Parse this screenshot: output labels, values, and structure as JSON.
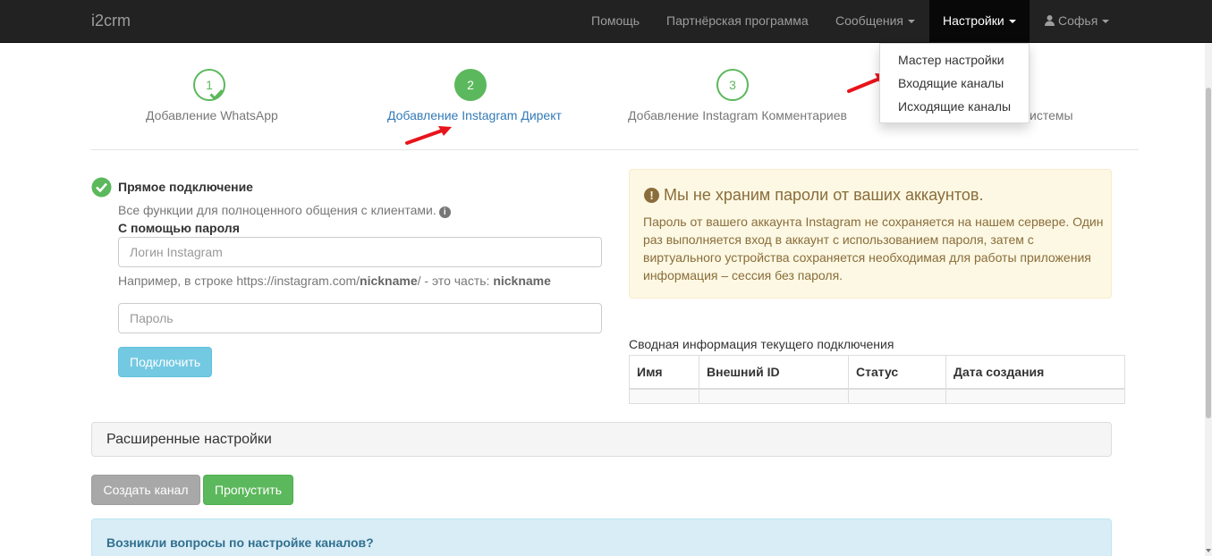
{
  "navbar": {
    "brand": "i2crm",
    "items": [
      {
        "label": "Помощь"
      },
      {
        "label": "Партнёрская программа"
      },
      {
        "label": "Сообщения"
      },
      {
        "label": "Настройки"
      },
      {
        "label": "Софья"
      }
    ],
    "settings_menu": [
      {
        "label": "Мастер настройки"
      },
      {
        "label": "Входящие каналы"
      },
      {
        "label": "Исходящие каналы"
      }
    ]
  },
  "steps": [
    {
      "number": "1",
      "label": "Добавление WhatsApp",
      "state": "done"
    },
    {
      "number": "2",
      "label": "Добавление Instagram Директ",
      "state": "active"
    },
    {
      "number": "3",
      "label": "Добавление Instagram Комментариев",
      "state": "pending"
    },
    {
      "label_visible_fragment": "истемы"
    }
  ],
  "connection": {
    "title": "Прямое подключение",
    "description": "Все функции для полноценного общения с клиентами.",
    "password_heading": "С помощью пароля",
    "login_placeholder": "Логин Instagram",
    "help_prefix": "Например, в строке https://instagram.com/",
    "help_nickname": "nickname",
    "help_middle": "/ - это часть: ",
    "help_suffix": "nickname",
    "password_placeholder": "Пароль",
    "connect_button": "Подключить"
  },
  "warning": {
    "title": "Мы не храним пароли от ваших аккаунтов.",
    "text": "Пароль от вашего аккаунта Instagram не сохраняется на нашем сервере. Один раз выполняется вход в аккаунт с использованием пароля, затем с виртуального устройства сохраняется необходимая для работы приложения информация – сессия без пароля."
  },
  "summary_table": {
    "caption": "Сводная информация текущего подключения",
    "headers": [
      "Имя",
      "Внешний ID",
      "Статус",
      "Дата создания"
    ]
  },
  "advanced": {
    "title": "Расширенные настройки"
  },
  "actions": {
    "create_channel": "Создать канал",
    "skip": "Пропустить"
  },
  "help_box": {
    "title": "Возникли вопросы по настройке каналов?"
  },
  "colors": {
    "navbar": "#222222",
    "success": "#5cb85c",
    "link": "#337ab7",
    "warning_bg": "#fcf8e3",
    "info_bg": "#d9edf7",
    "annotation_arrow": "#e8141b"
  }
}
